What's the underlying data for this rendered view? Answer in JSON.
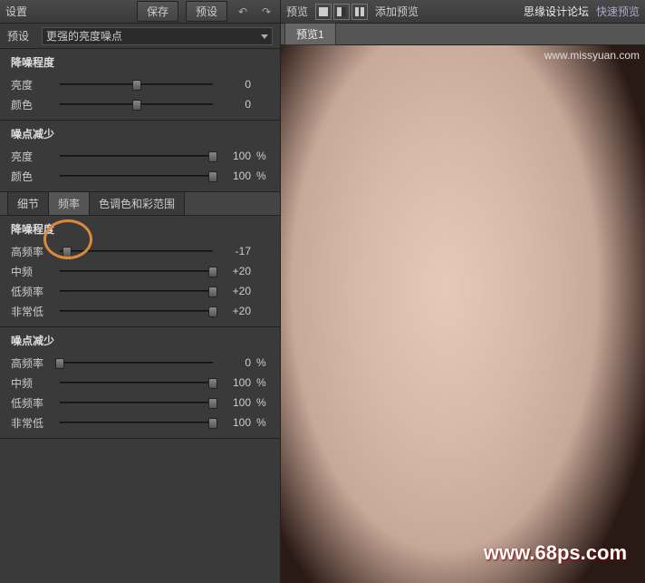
{
  "left": {
    "header": {
      "title": "设置",
      "save": "保存",
      "preset": "预设"
    },
    "presetRow": {
      "label": "预设",
      "value": "更强的亮度噪点"
    },
    "section1": {
      "title": "降噪程度",
      "rows": [
        {
          "label": "亮度",
          "value": "0",
          "unit": "",
          "pct": 50
        },
        {
          "label": "颜色",
          "value": "0",
          "unit": "",
          "pct": 50
        }
      ]
    },
    "section2": {
      "title": "噪点减少",
      "rows": [
        {
          "label": "亮度",
          "value": "100",
          "unit": "%",
          "pct": 100
        },
        {
          "label": "颜色",
          "value": "100",
          "unit": "%",
          "pct": 100
        }
      ]
    },
    "tabs": [
      {
        "label": "细节",
        "active": false
      },
      {
        "label": "频率",
        "active": true
      },
      {
        "label": "色调色和彩范围",
        "active": false
      }
    ],
    "section3": {
      "title": "降噪程度",
      "rows": [
        {
          "label": "高频率",
          "value": "-17",
          "unit": "",
          "pct": 5
        },
        {
          "label": "中频",
          "value": "+20",
          "unit": "",
          "pct": 100
        },
        {
          "label": "低频率",
          "value": "+20",
          "unit": "",
          "pct": 100
        },
        {
          "label": "非常低",
          "value": "+20",
          "unit": "",
          "pct": 100
        }
      ]
    },
    "section4": {
      "title": "噪点减少",
      "rows": [
        {
          "label": "高频率",
          "value": "0",
          "unit": "%",
          "pct": 0
        },
        {
          "label": "中频",
          "value": "100",
          "unit": "%",
          "pct": 100
        },
        {
          "label": "低频率",
          "value": "100",
          "unit": "%",
          "pct": 100
        },
        {
          "label": "非常低",
          "value": "100",
          "unit": "%",
          "pct": 100
        }
      ]
    }
  },
  "right": {
    "header": {
      "title": "预览",
      "add": "添加预览",
      "forum": "思缘设计论坛",
      "quick": "快速预览"
    },
    "previewTab": "预览1",
    "watermark": "www.68ps.com",
    "topWatermark": "www.missyuan.com"
  }
}
